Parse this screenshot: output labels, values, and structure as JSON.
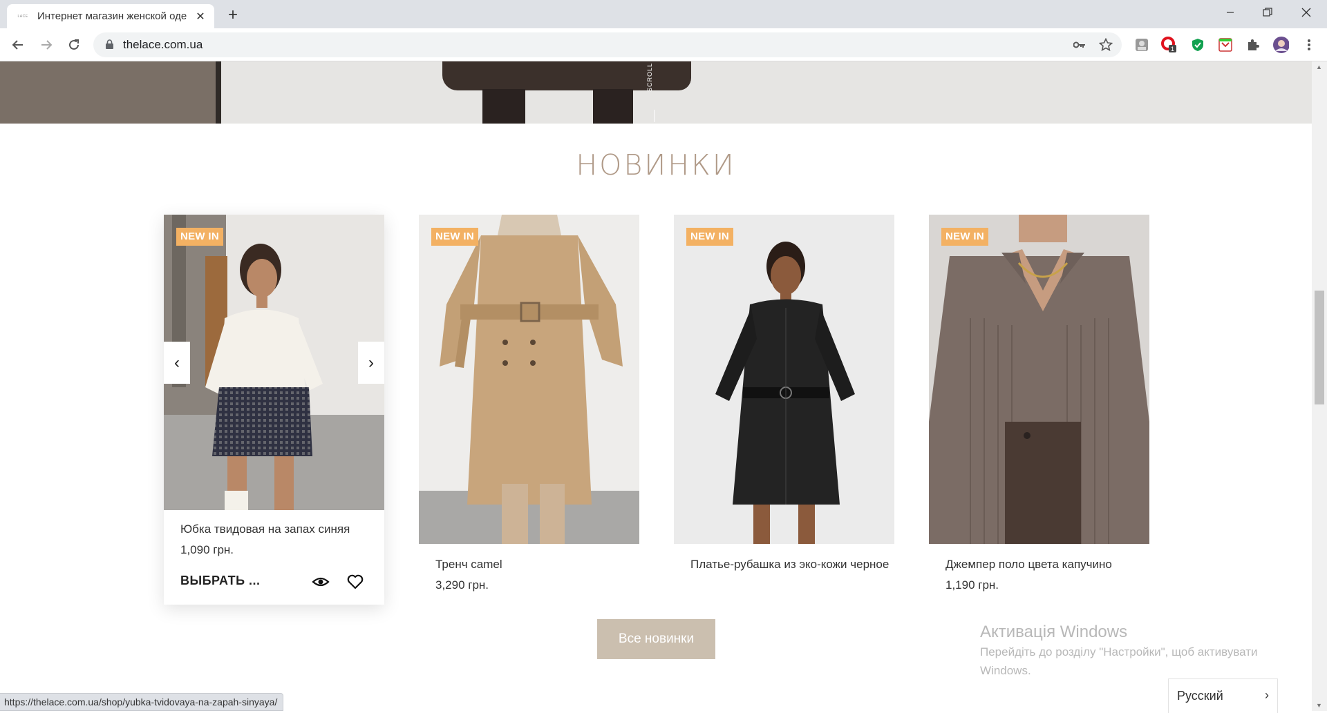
{
  "browser": {
    "tab_title": "Интернет магазин женской оде",
    "tab_favicon_text": "LACE",
    "url": "thelace.com.ua",
    "status_url": "https://thelace.com.ua/shop/yubka-tvidovaya-na-zapah-sinyaya/"
  },
  "hero": {
    "scroll_label": "SCROLL"
  },
  "section": {
    "title": "НОВИНКИ"
  },
  "products": [
    {
      "badge": "NEW IN",
      "name": "Юбка твидовая на запах синяя",
      "price": "1,090 грн.",
      "choose_label": "ВЫБРАТЬ ..."
    },
    {
      "badge": "NEW IN",
      "name": "Тренч camel",
      "price": "3,290 грн."
    },
    {
      "badge": "NEW IN",
      "name": "Платье-рубашка из эко-кожи черное",
      "price": ""
    },
    {
      "badge": "NEW IN",
      "name": "Джемпер поло цвета капучино",
      "price": "1,190 грн."
    }
  ],
  "all_button": "Все новинки",
  "windows_activation": {
    "title": "Активація Windows",
    "line1": "Перейдіть до розділу \"Настройки\", щоб активувати",
    "line2": "Windows."
  },
  "language": {
    "label": "Русский"
  },
  "colors": {
    "accent": "#b09a88",
    "badge": "#f3b163",
    "button": "#cbbfaf"
  }
}
